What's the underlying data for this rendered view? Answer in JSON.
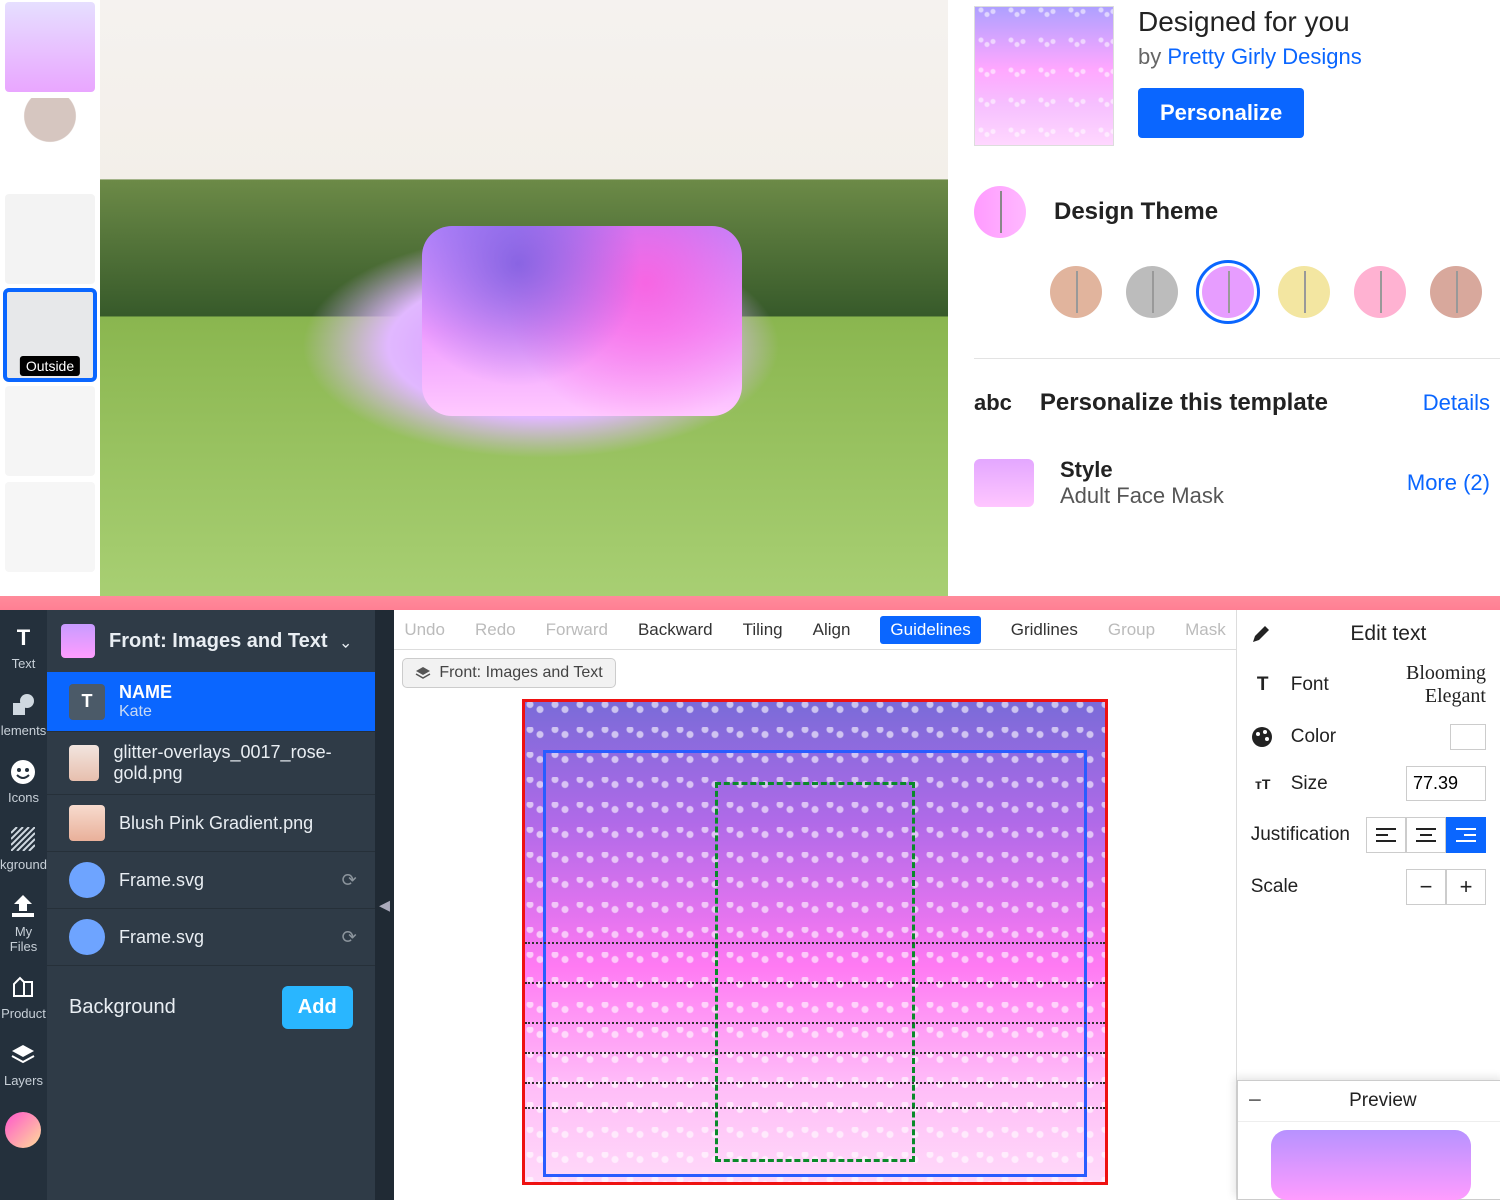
{
  "product": {
    "thumbnails": [
      {
        "label": ""
      },
      {
        "label": ""
      },
      {
        "label": ""
      },
      {
        "label": "Outside",
        "selected": true
      },
      {
        "label": ""
      },
      {
        "label": ""
      }
    ],
    "designed_for_you": "Designed for you",
    "by": "by",
    "designer": "Pretty Girly Designs",
    "personalize_btn": "Personalize",
    "theme_label": "Design Theme",
    "swatches": [
      {
        "color": "#e1b49d",
        "selected": false
      },
      {
        "color": "#bcbcbc",
        "selected": false
      },
      {
        "color": "#e79dff",
        "selected": true
      },
      {
        "color": "#f3e6a1",
        "selected": false
      },
      {
        "color": "#ffb2d2",
        "selected": false
      },
      {
        "color": "#d8a89c",
        "selected": false
      }
    ],
    "abc_icon_text": "abc",
    "personalize_template": "Personalize this template",
    "details": "Details",
    "style_label": "Style",
    "style_value": "Adult Face Mask",
    "more_label": "More (2)"
  },
  "editor_rail": [
    {
      "icon": "text-icon",
      "label": "Text"
    },
    {
      "icon": "elements-icon",
      "label": "lements"
    },
    {
      "icon": "icons-icon",
      "label": "Icons"
    },
    {
      "icon": "background-icon",
      "label": "kground"
    },
    {
      "icon": "myfiles-icon",
      "label": "My Files"
    },
    {
      "icon": "product-icon",
      "label": "Product"
    },
    {
      "icon": "layers-icon",
      "label": "Layers"
    }
  ],
  "layers": {
    "head": "Front: Images and Text",
    "items": [
      {
        "type": "text",
        "title": "NAME",
        "sub": "Kate",
        "selected": true
      },
      {
        "type": "img",
        "title": "glitter-overlays_0017_rose-gold.png"
      },
      {
        "type": "grad",
        "title": "Blush Pink Gradient.png"
      },
      {
        "type": "frame",
        "title": "Frame.svg"
      },
      {
        "type": "frame",
        "title": "Frame.svg"
      }
    ],
    "background_label": "Background",
    "add_btn": "Add"
  },
  "toolbar": {
    "undo": "Undo",
    "redo": "Redo",
    "forward": "Forward",
    "backward": "Backward",
    "tiling": "Tiling",
    "align": "Align",
    "guidelines": "Guidelines",
    "gridlines": "Gridlines",
    "group": "Group",
    "mask": "Mask"
  },
  "crumb_pill": "Front: Images and Text",
  "edit_panel": {
    "title": "Edit text",
    "font_label": "Font",
    "font_name": "Blooming Elegant",
    "color_label": "Color",
    "size_label": "Size",
    "size_value": "77.39",
    "justification_label": "Justification",
    "scale_label": "Scale",
    "preview_label": "Preview"
  }
}
